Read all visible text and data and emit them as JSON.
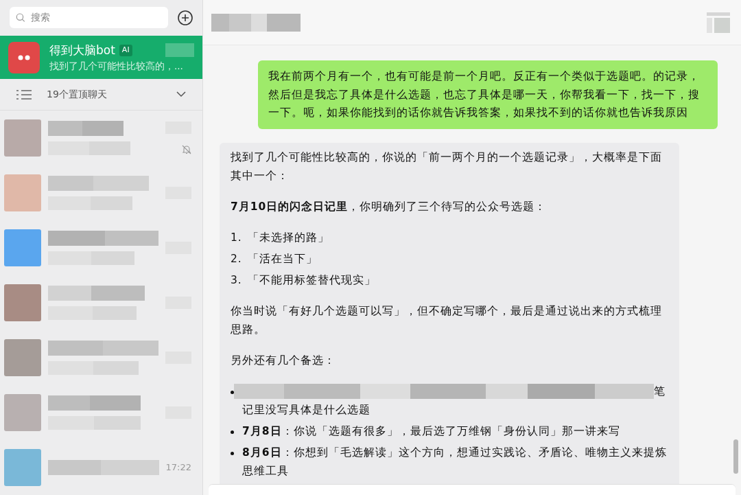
{
  "search": {
    "placeholder": "搜索"
  },
  "active_chat": {
    "name": "得到大脑bot",
    "badge": "AI",
    "preview": "找到了几个可能性比较高的，...",
    "selected": true
  },
  "pinned": {
    "label": "19个置顶聊天",
    "expanded": false
  },
  "chats": [
    {
      "color": "#b8aaa8",
      "muted": true
    },
    {
      "color": "#e0b8a8",
      "muted": false
    },
    {
      "color": "#5aa6ee",
      "muted": false
    },
    {
      "color": "#a88c84",
      "muted": false
    },
    {
      "color": "#a59c98",
      "muted": false
    },
    {
      "color": "#b8b0b0",
      "muted": false
    },
    {
      "color": "#7ab8d8",
      "muted": false,
      "time": "17:22"
    }
  ],
  "user_message": {
    "text": "我在前两个月有一个，也有可能是前一个月吧。反正有一个类似于选题吧。的记录，然后但是我忘了具体是什么选题，也忘了具体是哪一天，你帮我看一下，找一下，搜一下。呃，如果你能找到的话你就告诉我答案，如果找不到的话你就也告诉我原因"
  },
  "bot_message": {
    "blocks": [
      {
        "kind": "paragraph",
        "text": "找到了几个可能性比较高的，你说的「前一两个月的一个选题记录」，大概率是下面其中一个："
      },
      {
        "kind": "paragraph",
        "text": "**7月10日的闪念日记里**，你明确列了三个待写的公众号选题："
      },
      {
        "kind": "numbered",
        "items": [
          {
            "number": "1.",
            "text": "「未选择的路」"
          },
          {
            "number": "2.",
            "text": "「活在当下」"
          },
          {
            "number": "3.",
            "text": "「不能用标签替代现实」"
          }
        ]
      },
      {
        "kind": "paragraph",
        "text": "你当时说「有好几个选题可以写」，但不确定写哪个，最后是通过说出来的方式梳理思路。"
      },
      {
        "kind": "paragraph",
        "text": "另外还有几个备选："
      },
      {
        "kind": "bullets",
        "items": [
          {
            "redacted": true,
            "line_end": "笔",
            "text": "记里没写具体是什么选题"
          },
          {
            "redacted": false,
            "text": "**7月8日**：你说「选题有很多」，最后选了万维钢「身份认同」那一讲来写"
          },
          {
            "redacted": false,
            "text": "**8月6日**：你想到「毛选解读」这个方向，想通过实践论、矛盾论、唯物主义来提炼思维工具"
          }
        ]
      }
    ]
  }
}
